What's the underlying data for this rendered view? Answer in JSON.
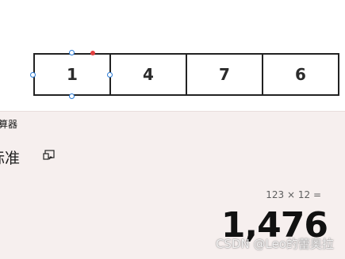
{
  "table": {
    "cells": [
      "1",
      "4",
      "7",
      "6"
    ]
  },
  "calculator": {
    "title": "计算器",
    "mode": "标准",
    "keep_on_top_icon": "keep-on-top-icon",
    "expression": "123 × 12 =",
    "result": "1,476"
  },
  "watermark": "CSDN @Leo的蕾奥拉",
  "colors": {
    "calc_background": "#f6efee",
    "handle_blue": "#2a7bd6",
    "handle_red": "#e34040"
  }
}
